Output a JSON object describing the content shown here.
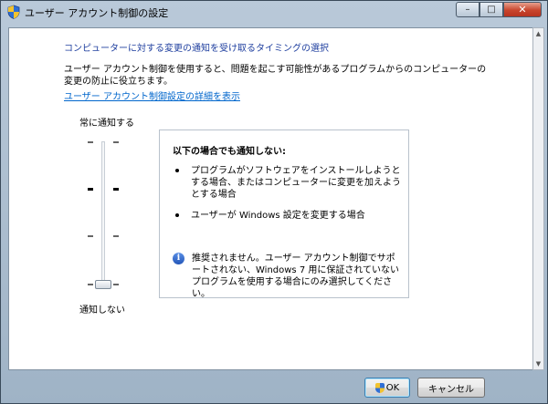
{
  "window": {
    "title": "ユーザー アカウント制御の設定",
    "minimize_glyph": "–",
    "maximize_glyph": "□",
    "close_glyph": "✕"
  },
  "content": {
    "heading": "コンピューターに対する変更の通知を受け取るタイミングの選択",
    "description": "ユーザー アカウント制御を使用すると、問題を起こす可能性があるプログラムからのコンピューターの変更の防止に役立ちます。",
    "link": "ユーザー アカウント制御設定の詳細を表示"
  },
  "slider": {
    "top_label": "常に通知する",
    "bottom_label": "通知しない",
    "levels": 4,
    "selected_level": 1
  },
  "info": {
    "title": "以下の場合でも通知しない:",
    "bullets": [
      "プログラムがソフトウェアをインストールしようとする場合、またはコンピューターに変更を加えようとする場合",
      "ユーザーが Windows 設定を変更する場合"
    ],
    "note_icon": "i",
    "note": "推奨されません。ユーザー アカウント制御でサポートされない、Windows 7 用に保証されていないプログラムを使用する場合にのみ選択してください。"
  },
  "buttons": {
    "ok": "OK",
    "cancel": "キャンセル"
  },
  "scrollbar": {
    "up_glyph": "▲",
    "down_glyph": "▼"
  }
}
